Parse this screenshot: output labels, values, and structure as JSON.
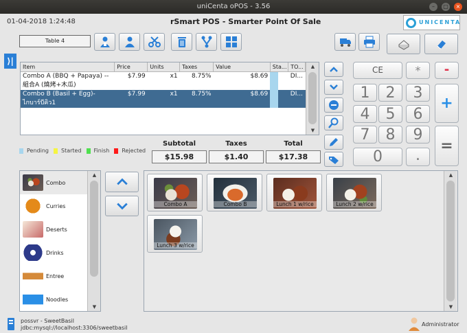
{
  "window": {
    "title": "uniCenta oPOS - 3.56"
  },
  "header": {
    "datetime": "01-04-2018 1:24:48",
    "app_title": "rSmart POS - Smarter Point Of Sale",
    "logo_text": "UNICENTA"
  },
  "toolbar": {
    "table_label": "Table 4"
  },
  "ticket": {
    "columns": [
      "Item",
      "Price",
      "Units",
      "Taxes",
      "Value",
      "Sta...",
      "TO..."
    ],
    "rows": [
      {
        "item_line1": "Combo A (BBQ + Papaya) --",
        "item_line2": "組合A (燒烤+木瓜)",
        "price": "$7.99",
        "units": "x1",
        "taxes": "8.75%",
        "value": "$8.69",
        "to": "DI..."
      },
      {
        "item_line1": "Combo B (Basil + Egg)-",
        "item_line2": "ไกบาร์บีคิว1",
        "price": "$7.99",
        "units": "x1",
        "taxes": "8.75%",
        "value": "$8.69",
        "to": "DI..."
      }
    ]
  },
  "legend": {
    "pending": "Pending",
    "started": "Started",
    "finish": "Finish",
    "rejected": "Rejected"
  },
  "totals": {
    "subtotal_label": "Subtotal",
    "subtotal": "$15.98",
    "taxes_label": "Taxes",
    "taxes": "$1.40",
    "total_label": "Total",
    "total": "$17.38"
  },
  "keypad": {
    "ce": "CE",
    "star": "*",
    "minus": "-",
    "plus": "+",
    "equals": "=",
    "dot": ".",
    "digits": [
      "1",
      "2",
      "3",
      "4",
      "5",
      "6",
      "7",
      "8",
      "9",
      "0"
    ]
  },
  "categories": [
    {
      "label": "Combo"
    },
    {
      "label": "Curries"
    },
    {
      "label": "Deserts"
    },
    {
      "label": "Drinks"
    },
    {
      "label": "Entree"
    },
    {
      "label": "Noodles"
    }
  ],
  "products": [
    {
      "label": "Combo A"
    },
    {
      "label": "Combo B"
    },
    {
      "label": "Lunch 1 w/rice"
    },
    {
      "label": "Lunch 2 w/rice"
    },
    {
      "label": "Lunch 3 w/rice"
    }
  ],
  "status": {
    "server": "possvr - SweetBasil",
    "jdbc": "jdbc:mysql://localhost:3306/sweetbasil",
    "user": "Administrator"
  },
  "colors": {
    "accent": "#2a7fd6",
    "selected_row": "#3f6b92",
    "pending": "#a8d6ee",
    "started": "#f5f542",
    "finish": "#4fe04f",
    "rejected": "#ff1a1a"
  }
}
